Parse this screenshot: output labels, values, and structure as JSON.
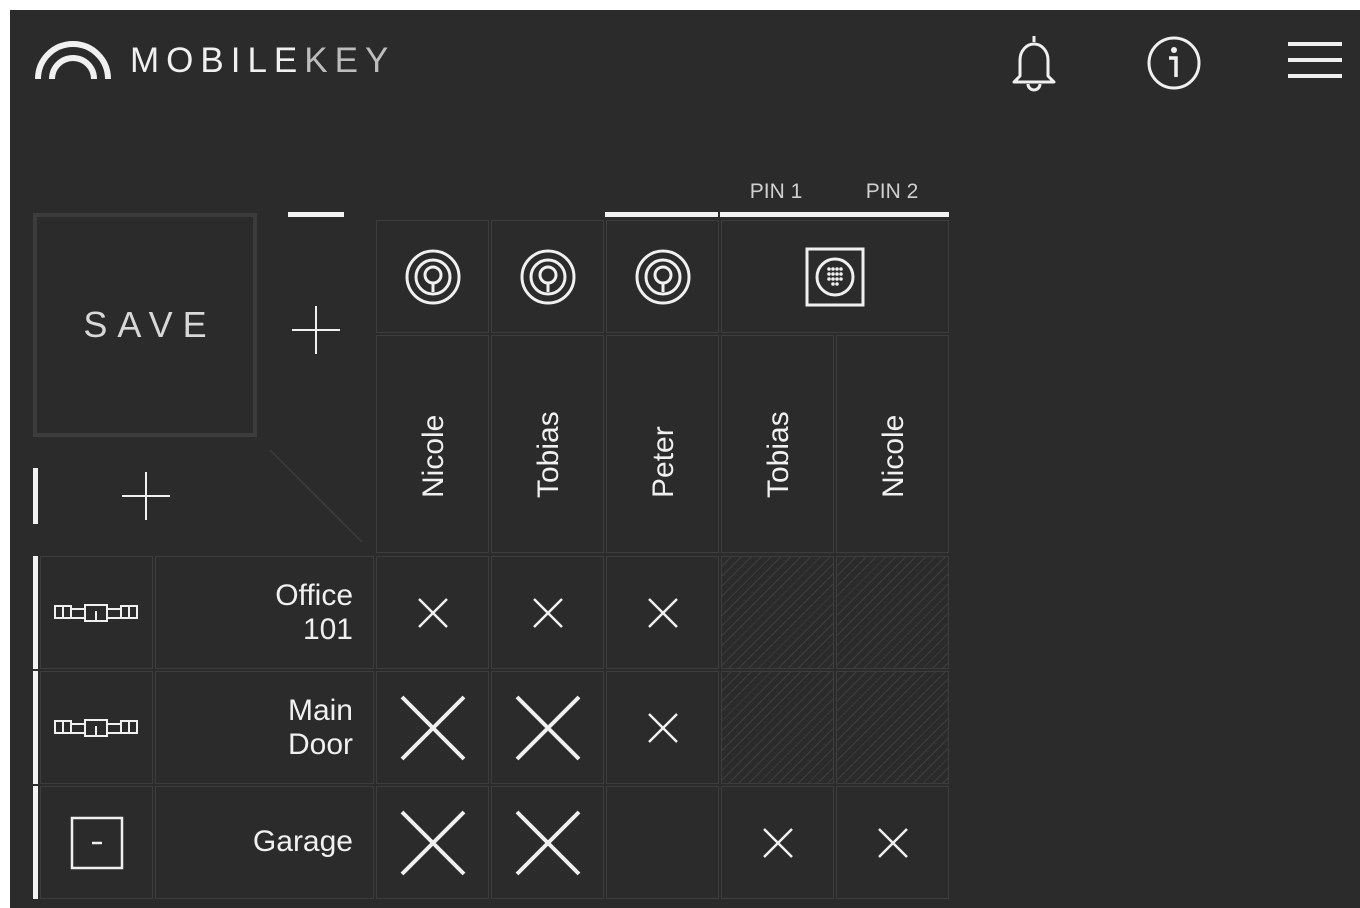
{
  "header": {
    "brand_bold": "MOBILE",
    "brand_light": "KEY",
    "icons": [
      "logo-arc-icon",
      "bell-icon",
      "info-icon",
      "hamburger-menu-icon"
    ]
  },
  "toolbar": {
    "save_label": "SAVE"
  },
  "pins": {
    "pin1": "PIN 1",
    "pin2": "PIN 2"
  },
  "users": [
    {
      "name": "Nicole",
      "type": "transponder"
    },
    {
      "name": "Tobias",
      "type": "transponder"
    },
    {
      "name": "Peter",
      "type": "transponder"
    },
    {
      "name": "Tobias",
      "type": "pin-code"
    },
    {
      "name": "Nicole",
      "type": "pin-code"
    }
  ],
  "doors": [
    {
      "line1": "Office",
      "line2": "101",
      "icon": "cylinder-lock-icon"
    },
    {
      "line1": "Main",
      "line2": "Door",
      "icon": "cylinder-lock-icon"
    },
    {
      "line1": "Garage",
      "line2": "",
      "icon": "garage-door-icon"
    }
  ],
  "matrix": [
    [
      "small-x",
      "small-x",
      "small-x",
      "hatched",
      "hatched"
    ],
    [
      "large-x",
      "large-x",
      "small-x",
      "hatched",
      "hatched"
    ],
    [
      "large-x",
      "large-x",
      "empty",
      "small-x",
      "small-x"
    ]
  ],
  "colors": {
    "background": "#2b2b2b",
    "grid": "#3d3d3d",
    "foreground": "#f2f2f2"
  }
}
